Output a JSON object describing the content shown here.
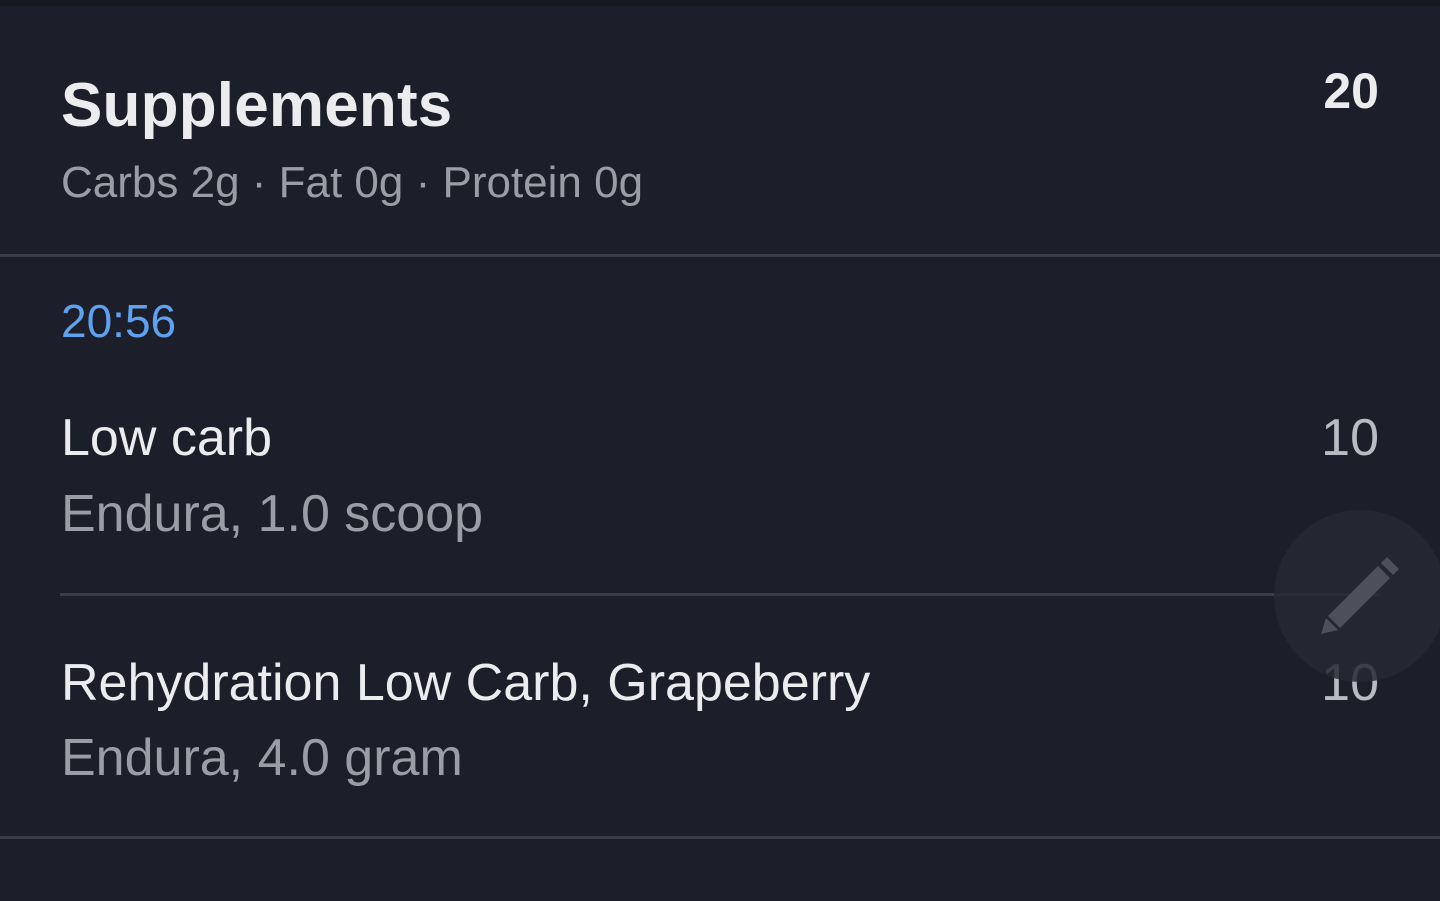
{
  "section": {
    "title": "Supplements",
    "total": "20",
    "macros": "Carbs 2g · Fat 0g · Protein 0g"
  },
  "log": {
    "time": "20:56",
    "items": [
      {
        "name": "Low carb",
        "detail": "Endura, 1.0 scoop",
        "calories": "10"
      },
      {
        "name": "Rehydration Low Carb, Grapeberry",
        "detail": "Endura, 4.0 gram",
        "calories": "10"
      }
    ]
  },
  "fab": {
    "icon": "pencil-icon"
  },
  "colors": {
    "background": "#1c1f2a",
    "accent_time": "#5ea1f0",
    "primary_text": "#ececef",
    "secondary_text": "#9a9da6",
    "divider": "#3a3d47"
  }
}
